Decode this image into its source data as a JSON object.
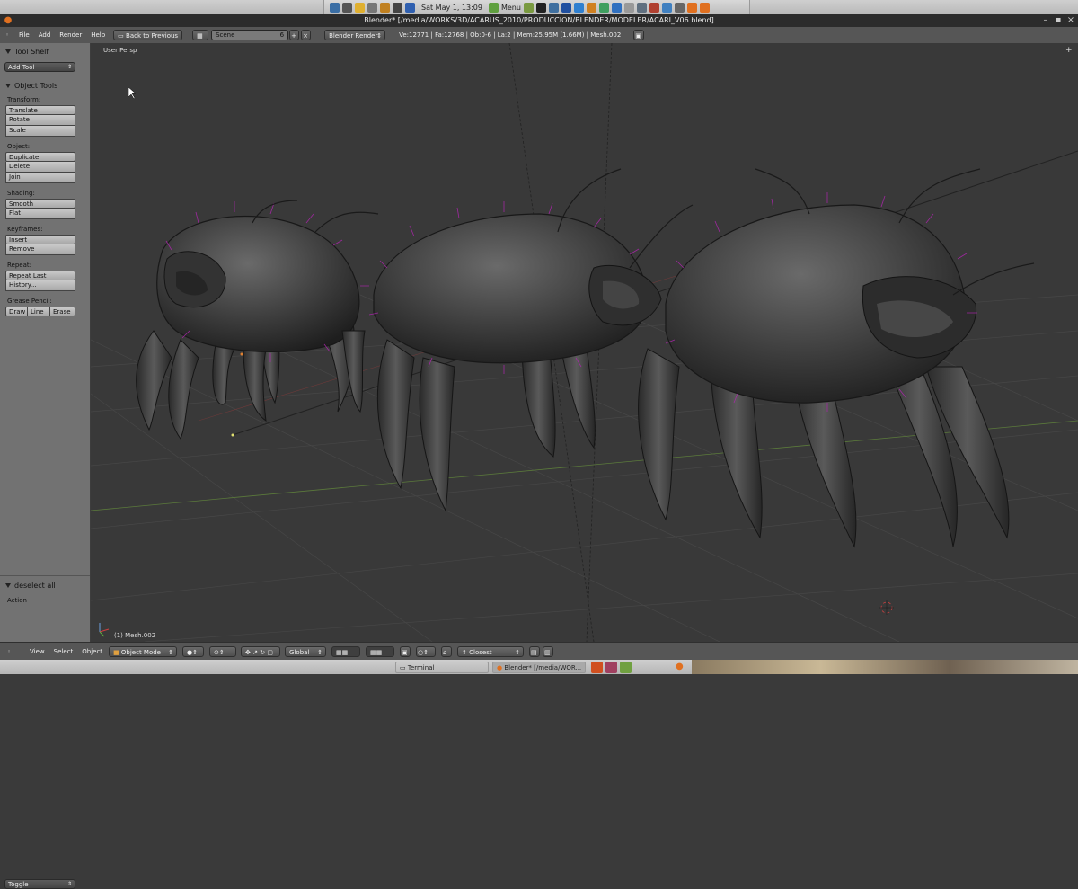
{
  "system": {
    "clock": "Sat May  1, 13:09",
    "menu_label": "Menu"
  },
  "window": {
    "title": "Blender* [/media/WORKS/3D/ACARUS_2010/PRODUCCION/BLENDER/MODELER/ACARI_V06.blend]"
  },
  "header": {
    "menus": [
      "File",
      "Add",
      "Render",
      "Help"
    ],
    "back_button": "Back to Previous",
    "scene": "Scene",
    "scene_users": "6",
    "render_engine": "Blender Render",
    "stats": "Ve:12771 | Fa:12768 | Ob:0-6 | La:2 | Mem:25.95M (1.66M) | Mesh.002"
  },
  "tool_shelf": {
    "title": "Tool Shelf",
    "add_tool": "Add Tool",
    "object_tools_title": "Object Tools",
    "sections": {
      "transform": {
        "label": "Transform:",
        "buttons": [
          "Translate",
          "Rotate",
          "Scale"
        ]
      },
      "object": {
        "label": "Object:",
        "buttons": [
          "Duplicate",
          "Delete",
          "Join"
        ]
      },
      "shading": {
        "label": "Shading:",
        "buttons": [
          "Smooth",
          "Flat"
        ]
      },
      "keyframes": {
        "label": "Keyframes:",
        "buttons": [
          "Insert",
          "Remove"
        ]
      },
      "repeat": {
        "label": "Repeat:",
        "buttons": [
          "Repeat Last",
          "History..."
        ]
      },
      "grease": {
        "label": "Grease Pencil:",
        "buttons": [
          "Draw",
          "Line",
          "Erase"
        ]
      }
    },
    "operator_title": "deselect all",
    "action_label": "Action",
    "action_value": "Toggle"
  },
  "viewport": {
    "view_name": "User Persp",
    "object_name": "(1) Mesh.002"
  },
  "footer": {
    "menus": [
      "View",
      "Select",
      "Object"
    ],
    "mode": "Object Mode",
    "orientation": "Global",
    "snap": "Closest"
  },
  "taskbar": {
    "terminal": "Terminal",
    "blender": "Blender* [/media/WOR..."
  }
}
